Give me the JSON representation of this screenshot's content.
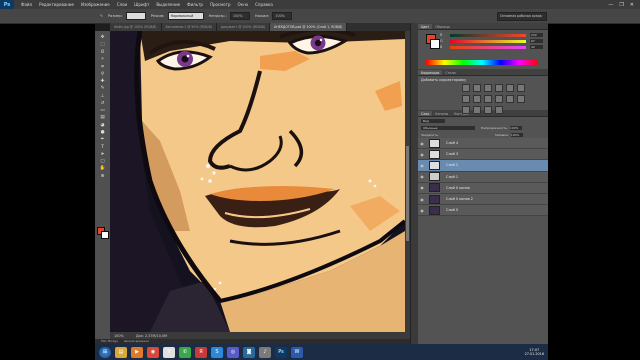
{
  "app": {
    "logo": "Ps"
  },
  "menu": [
    "Файл",
    "Редактирование",
    "Изображение",
    "Слои",
    "Шрифт",
    "Выделение",
    "Фильтр",
    "Просмотр",
    "Окно",
    "Справка"
  ],
  "window_controls": [
    "—",
    "❐",
    "✕"
  ],
  "options": {
    "size_label": "Размер:",
    "style_label": "Нормальный",
    "mode_label": "Режим:",
    "mode_value": "Нормальный",
    "opacity_label": "Непрозр.:",
    "opacity_value": "100%",
    "flow_label": "Нажим:",
    "flow_value": "100%",
    "workspace": "Основная рабочая среда"
  },
  "tabs": [
    {
      "label": "Файл.jpg @ 100% (RGB/8)",
      "active": false
    },
    {
      "label": "Без имени-1 @ 50% (RGB/8)",
      "active": false
    },
    {
      "label": "документ @ 100% (RGB/8)",
      "active": false
    },
    {
      "label": "АНЕКДОТОВ.psd @ 100% (Слой 1, RGB/8)",
      "active": true
    }
  ],
  "tools": [
    "move-icon",
    "marquee-icon",
    "lasso-icon",
    "magic-wand-icon",
    "crop-icon",
    "eyedropper-icon",
    "healing-icon",
    "brush-icon",
    "stamp-icon",
    "history-brush-icon",
    "eraser-icon",
    "gradient-icon",
    "blur-icon",
    "dodge-icon",
    "pen-icon",
    "type-icon",
    "path-select-icon",
    "shape-icon",
    "hand-icon",
    "zoom-icon"
  ],
  "status": {
    "zoom": "100%",
    "doc": "Док: 2,37M/10,0M"
  },
  "minibridge": [
    "Mini Bridge",
    "Шкала времени"
  ],
  "color_panel": {
    "tabs": [
      "Цвет",
      "Образцы"
    ],
    "foreground": "#e8432a",
    "background": "#ffffff",
    "channels": [
      {
        "label": "R",
        "value": "232"
      },
      {
        "label": "G",
        "value": "67"
      },
      {
        "label": "B",
        "value": "42"
      }
    ]
  },
  "adjustments_panel": {
    "tabs": [
      "Коррекция",
      "Стили"
    ],
    "title": "Добавить корректировку"
  },
  "layers_panel": {
    "tabs": [
      "Слои",
      "Каналы",
      "Контуры"
    ],
    "kind": "Вид",
    "blend": "Обычные",
    "opacity_label": "Непрозрачность:",
    "opacity_value": "100%",
    "lock_label": "Закрепить:",
    "fill_label": "Заливка:",
    "fill_value": "100%",
    "layers": [
      {
        "name": "Слой 4",
        "selected": false,
        "thumb": "light"
      },
      {
        "name": "Слой 3",
        "selected": false,
        "thumb": "light"
      },
      {
        "name": "Слой 2",
        "selected": true,
        "thumb": "light"
      },
      {
        "name": "Слой 1",
        "selected": false,
        "thumb": "checker"
      },
      {
        "name": "Слой 0 копия",
        "selected": false,
        "thumb": "dark"
      },
      {
        "name": "Слой 0 копия 2",
        "selected": false,
        "thumb": "dark"
      },
      {
        "name": "Слой 0",
        "selected": false,
        "thumb": "dark"
      }
    ]
  },
  "taskbar": {
    "time": "17:07",
    "date": "27.01.2016"
  }
}
